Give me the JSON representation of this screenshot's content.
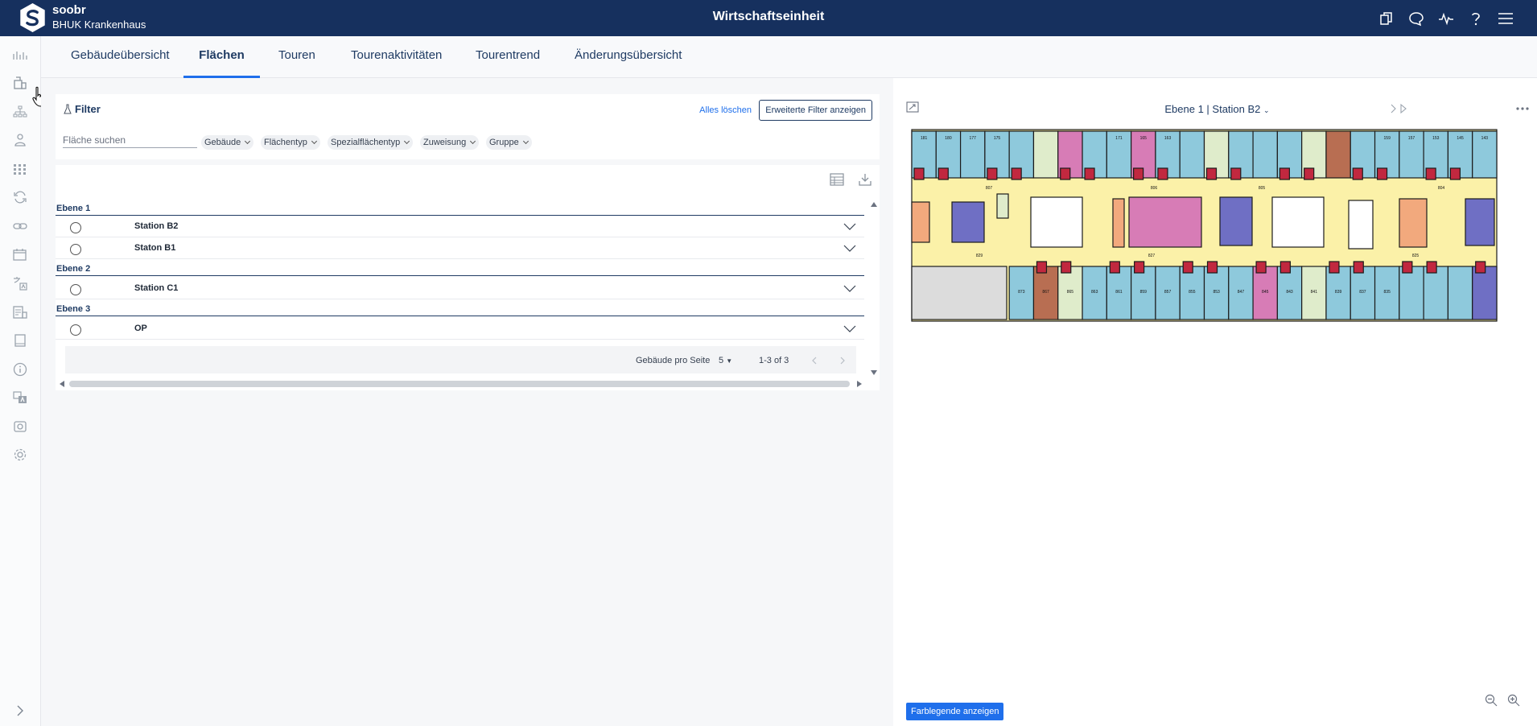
{
  "brand": {
    "name": "soobr",
    "org": "BHUK Krankenhaus"
  },
  "app": {
    "title": "Wirtschaftseinheit"
  },
  "top_icons": [
    "copy-icon",
    "chat-icon",
    "activity-icon",
    "help-icon",
    "menu-icon"
  ],
  "tabs": [
    {
      "label": "Gebäudeübersicht",
      "active": false
    },
    {
      "label": "Flächen",
      "active": true
    },
    {
      "label": "Touren",
      "active": false
    },
    {
      "label": "Tourenaktivitäten",
      "active": false
    },
    {
      "label": "Tourentrend",
      "active": false
    },
    {
      "label": "Änderungsübersicht",
      "active": false
    }
  ],
  "filter": {
    "title": "Filter",
    "clear_label": "Alles löschen",
    "advanced_label": "Erweiterte Filter anzeigen",
    "search_placeholder": "Fläche suchen",
    "chips": [
      "Gebäude",
      "Flächentyp",
      "Spezialflächentyp",
      "Zuweisung",
      "Gruppe"
    ]
  },
  "levels": [
    {
      "name": "Ebene 1",
      "rows": [
        "Station B2",
        "Staton B1"
      ]
    },
    {
      "name": "Ebene 2",
      "rows": [
        "Station C1"
      ]
    },
    {
      "name": "Ebene 3",
      "rows": [
        "OP"
      ]
    }
  ],
  "pager": {
    "per_page_label": "Gebäude pro Seite",
    "per_page_value": "5",
    "range": "1-3 of 3"
  },
  "plan": {
    "title": "Ebene 1 | Station B2",
    "legend_button": "Farblegende anzeigen",
    "room_labels": [
      "181",
      "180",
      "177",
      "175",
      "171",
      "165",
      "163",
      "159",
      "157",
      "153",
      "145",
      "143",
      "142",
      "136",
      "137",
      "135",
      "807",
      "805",
      "806",
      "804",
      "829",
      "827",
      "825",
      "873",
      "867",
      "865",
      "863",
      "861",
      "859",
      "857",
      "855",
      "853",
      "847",
      "845",
      "843",
      "841",
      "839",
      "837",
      "835"
    ]
  },
  "colors": {
    "topbar": "#16305e",
    "accent": "#1f6feb",
    "room_blue": "#8ec9dc",
    "room_yellow": "#fbf1a8",
    "room_pink": "#d77cb6",
    "room_purple": "#6f6fc4",
    "room_green": "#dfeccb",
    "room_brown": "#b86e52",
    "room_orange": "#f2a97d",
    "room_red": "#c1283f"
  }
}
